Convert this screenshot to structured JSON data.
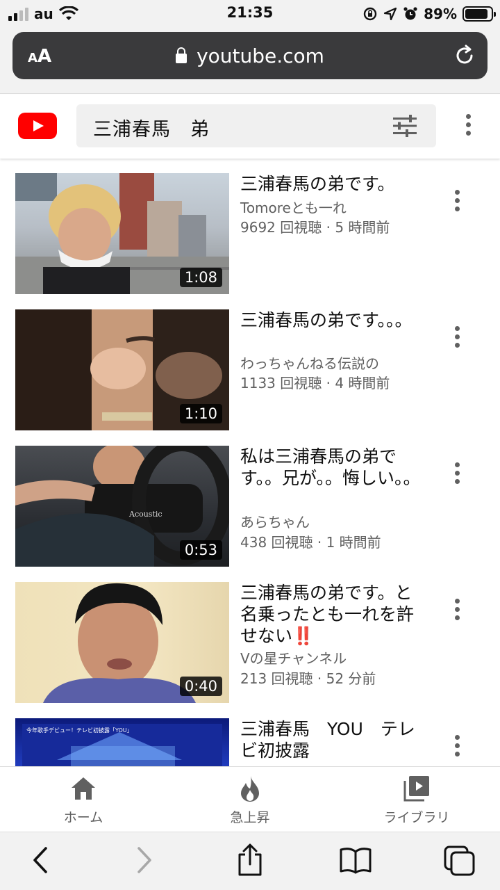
{
  "status_bar": {
    "carrier": "au",
    "time": "21:35",
    "battery": "89%",
    "battery_level": 0.89,
    "signal_bars": 4,
    "signal_active": 2,
    "icons": [
      "wifi-icon",
      "orientation-lock-icon",
      "location-icon",
      "alarm-icon",
      "battery-icon"
    ]
  },
  "browser": {
    "text_size_label": "AA",
    "url": "youtube.com",
    "icons": [
      "lock-icon",
      "reload-icon"
    ]
  },
  "youtube_header": {
    "search_query": "三浦春馬　弟",
    "icons": [
      "youtube-logo-icon",
      "filter-icon",
      "more-icon"
    ]
  },
  "videos": [
    {
      "title": "三浦春馬の弟です。",
      "channel": "Tomoreとも一れ",
      "stats": "9692 回視聴 · 5 時間前",
      "duration": "1:08"
    },
    {
      "title": "三浦春馬の弟です。。。",
      "channel": "わっちゃんねる伝説の",
      "stats": "1133 回視聴 · 4 時間前",
      "duration": "1:10"
    },
    {
      "title": "私は三浦春馬の弟です。。兄が。。悔しい。。",
      "channel": "あらちゃん",
      "stats": "438 回視聴 · 1 時間前",
      "duration": "0:53"
    },
    {
      "title": "三浦春馬の弟です。と名乗ったとも一れを許せない‼️",
      "channel": "Vの星チャンネル",
      "stats": "213 回視聴 · 52 分前",
      "duration": "0:40"
    },
    {
      "title": "三浦春馬　YOU　テレビ初披露",
      "channel": "",
      "stats": "",
      "duration": ""
    }
  ],
  "thumb_texts": {
    "t3_shirt": "Acoustic",
    "t5_caption": "今年歌手デビュー！テレビ初披露「YOU」"
  },
  "youtube_nav": {
    "items": [
      {
        "label": "ホーム",
        "icon": "home-icon"
      },
      {
        "label": "急上昇",
        "icon": "trending-flame-icon"
      },
      {
        "label": "ライブラリ",
        "icon": "library-icon"
      }
    ]
  },
  "safari_toolbar": {
    "icons": [
      "back-icon",
      "forward-icon",
      "share-icon",
      "bookmarks-icon",
      "tabs-icon"
    ]
  },
  "colors": {
    "youtube_red": "#ff0000",
    "text_primary": "#0f0f0f",
    "text_secondary": "#606060",
    "url_bar": "#3a3a3c"
  }
}
